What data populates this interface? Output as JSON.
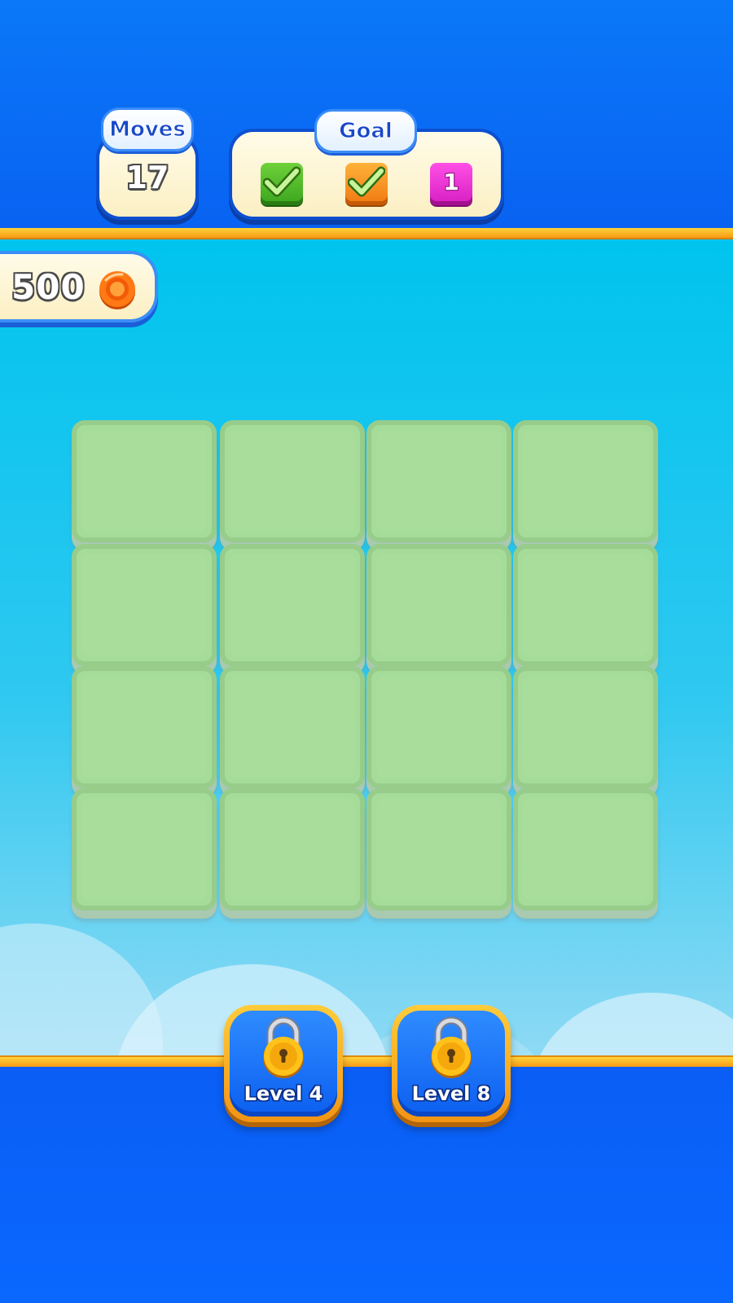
{
  "hud": {
    "moves_label": "Moves",
    "moves_value": "17",
    "goal_label": "Goal",
    "goals": [
      {
        "color": "#3aa51e",
        "state": "done",
        "icon": "check-icon"
      },
      {
        "color": "#f07812",
        "state": "done",
        "icon": "check-icon"
      },
      {
        "color": "#d61ec2",
        "state": "remaining",
        "count": "1"
      }
    ]
  },
  "coins": {
    "value": "500",
    "icon": "coin-icon"
  },
  "board": {
    "rows": 4,
    "cols": 4,
    "tile_color": "#a6dc9a"
  },
  "levels": [
    {
      "label": "Level 4",
      "locked": true,
      "icon": "lock-icon"
    },
    {
      "label": "Level 8",
      "locked": true,
      "icon": "lock-icon"
    }
  ],
  "colors": {
    "sky_top": "#00c4ee",
    "bar_blue": "#0a66ff",
    "stripe_orange": "#f59a14"
  }
}
